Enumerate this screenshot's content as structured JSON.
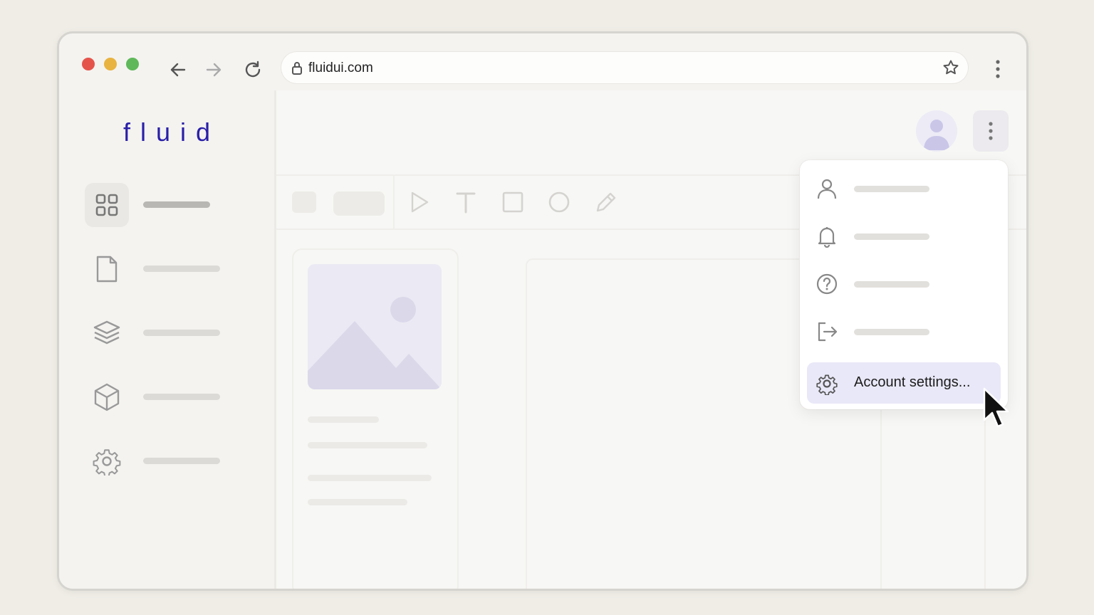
{
  "browser": {
    "url": "fluidui.com",
    "icons": [
      "back-arrow-icon",
      "forward-arrow-icon",
      "reload-icon",
      "lock-icon",
      "star-icon",
      "kebab-menu-icon"
    ],
    "traffic_lights": [
      "#e5544b",
      "#e8b340",
      "#5fb859"
    ]
  },
  "app": {
    "logo": "fluid",
    "brand_color": "#2a1fa8",
    "sidebar_items": [
      {
        "icon": "grid-icon",
        "active": true
      },
      {
        "icon": "document-icon",
        "active": false
      },
      {
        "icon": "layers-icon",
        "active": false
      },
      {
        "icon": "cube-icon",
        "active": false
      },
      {
        "icon": "settings-gear-icon",
        "active": false
      }
    ],
    "toolbar_icons": [
      "play-icon",
      "text-icon",
      "square-icon",
      "circle-icon",
      "pencil-icon"
    ]
  },
  "dropdown": {
    "items": [
      {
        "icon": "user-icon"
      },
      {
        "icon": "bell-icon"
      },
      {
        "icon": "help-icon"
      },
      {
        "icon": "logout-icon"
      },
      {
        "icon": "gear-icon",
        "label": "Account settings..."
      }
    ],
    "highlight_color": "#e9e8f8"
  }
}
